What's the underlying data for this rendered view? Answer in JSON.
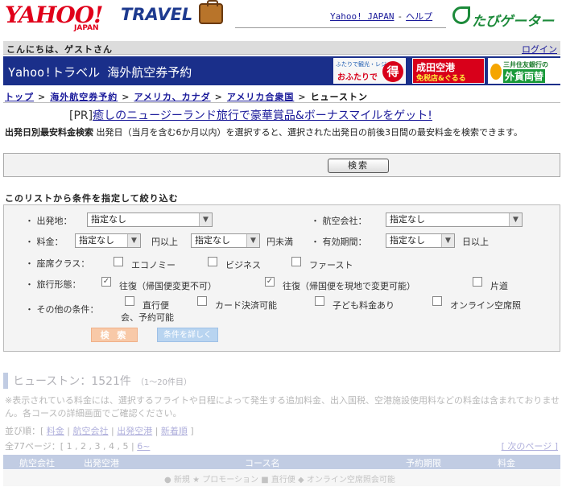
{
  "header": {
    "logo_yahoo": "YAHOO!",
    "logo_japan": "JAPAN",
    "logo_travel": "TRAVEL",
    "link_yahoo_japan": "Yahoo! JAPAN",
    "link_sep": "-",
    "link_help": "ヘルプ",
    "tabigator": "たびゲーター"
  },
  "greeting": {
    "text": "こんにちは、ゲストさん",
    "login": "ログイン"
  },
  "titlebar": {
    "title": "Yahoo!トラベル 海外航空券予約",
    "banner1_top": "ふたりで観光・レジャー",
    "banner1_main": "おふたりで",
    "banner1_badge": "得",
    "banner2_top": "成田空港",
    "banner2_bottom": "免税店&ぐるる",
    "banner3_top": "三井住友銀行の",
    "banner3_main": "外貨両替"
  },
  "breadcrumb": {
    "items": [
      "トップ",
      "海外航空券予約",
      "アメリカ、カナダ",
      "アメリカ合衆国"
    ],
    "current": "ヒューストン",
    "separator": ">"
  },
  "pr": {
    "tag": "[PR]",
    "text": "癒しのニュージーランド旅行で豪華賞品&ボーナスマイルをゲット!"
  },
  "description": {
    "bold": "出発日別最安料金検索",
    "text": " 出発日（当月を含む6か月以内）を選択すると、選択された出発日の前後3日間の最安料金を検索できます。"
  },
  "search": {
    "button": "検索"
  },
  "filter": {
    "heading": "このリストから条件を指定して絞り込む",
    "departure_label": "・ 出発地：",
    "departure_value": "指定なし",
    "airline_label": "・ 航空会社：",
    "airline_value": "指定なし",
    "price_label": "・ 料金：",
    "price_min_value": "指定なし",
    "price_min_suffix": "円以上",
    "price_max_value": "指定なし",
    "price_max_suffix": "円未満",
    "validity_label": "・ 有効期間：",
    "validity_value": "指定なし",
    "validity_suffix": "日以上",
    "seat_label": "・ 座席クラス：",
    "seat_economy": "エコノミー",
    "seat_business": "ビジネス",
    "seat_first": "ファースト",
    "trip_label": "・ 旅行形態：",
    "trip_round_fixed": "往復（帰国便変更不可）",
    "trip_round_changeable": "往復（帰国便を現地で変更可能）",
    "trip_oneway": "片道",
    "other_label": "・ その他の条件：",
    "other_direct": "直行便",
    "other_card": "カード決済可能",
    "other_child": "子ども料金あり",
    "other_online_1": "オンライン空席照",
    "other_online_2": "会、予約可能",
    "search_button": "検 索",
    "detail_button": "条件を詳しく"
  },
  "results": {
    "title": "ヒューストン：1521件",
    "range": "（1～20件目）",
    "note": "※表示されている料金には、選択するフライトや日程によって発生する追加料金、出入国税、空港施設使用料などの料金は含まれておりません。各コースの詳細画面でご確認ください。",
    "sort_label": "並び順：[",
    "sort_items": [
      "料金",
      "航空会社",
      "出発空港",
      "新着順"
    ],
    "sort_end": "]",
    "pager": "全77ページ：[ 1 , 2 , 3 , 4 , 5 | ",
    "pager_next_small": "6~",
    "next_page": "[ 次のページ ]",
    "columns": [
      "航空会社",
      "出発空港",
      "コース名",
      "予約期限",
      "料金"
    ],
    "footer": "● 新規 ★ プロモーション ■ 直行便 ◆ オンライン空席照会可能"
  }
}
